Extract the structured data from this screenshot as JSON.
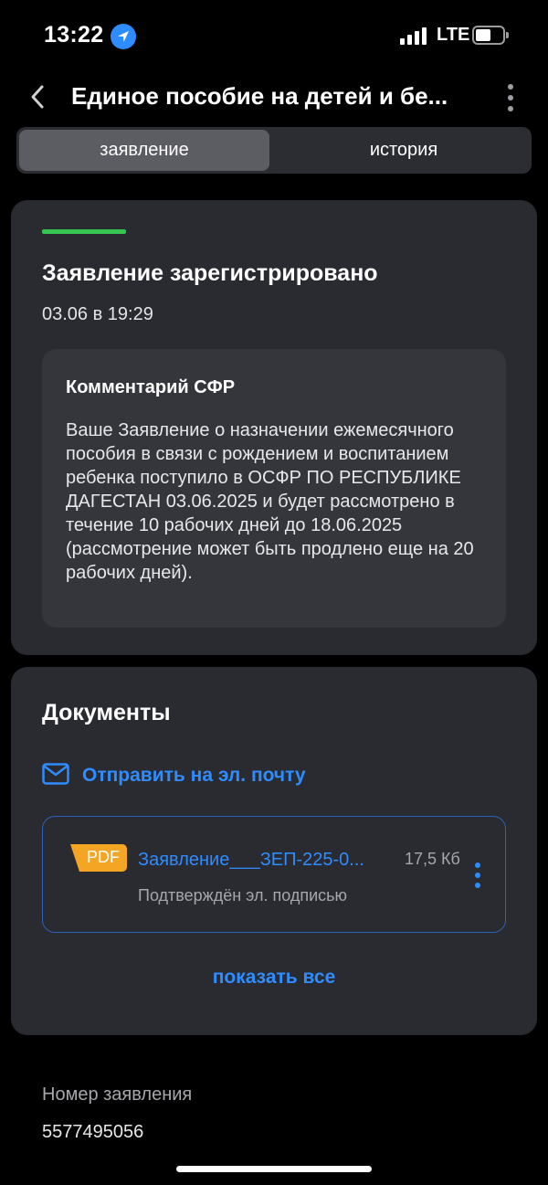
{
  "status_bar": {
    "time": "13:22",
    "network": "LTE",
    "location_icon": "location-arrow-icon",
    "signal_icon": "cellular-signal-icon",
    "battery_icon": "battery-icon"
  },
  "header": {
    "title": "Единое пособие на детей и бе...",
    "back_icon": "chevron-left-icon",
    "more_icon": "vertical-ellipsis-icon"
  },
  "tabs": [
    {
      "label": "заявление",
      "active": true
    },
    {
      "label": "история",
      "active": false
    }
  ],
  "status_card": {
    "accent_color": "#36c553",
    "title": "Заявление зарегистрировано",
    "date": "03.06 в 19:29",
    "comment": {
      "title": "Комментарий СФР",
      "text": "Ваше Заявление о назначении ежемесячного пособия в связи с рождением и воспитанием ребенка поступило в ОСФР ПО РЕСПУБЛИКЕ ДАГЕСТАН 03.06.2025 и будет рассмотрено в течение 10 рабочих дней до 18.06.2025 (рассмотрение может быть продлено еще на 20 рабочих дней)."
    }
  },
  "documents": {
    "title": "Документы",
    "send_email_label": "Отправить на эл. почту",
    "mail_icon": "envelope-icon",
    "items": [
      {
        "type_badge": "PDF",
        "name": "Заявление___ЗЕП-225-0...",
        "size": "17,5 Кб",
        "signature": "Подтверждён эл. подписью"
      }
    ],
    "show_all_label": "показать все"
  },
  "application": {
    "number_label": "Номер заявления",
    "number_value": "5577495056"
  },
  "colors": {
    "background": "#000000",
    "card": "#2a2b31",
    "accent_blue": "#2f8cff",
    "pdf_orange": "#f5a524"
  }
}
